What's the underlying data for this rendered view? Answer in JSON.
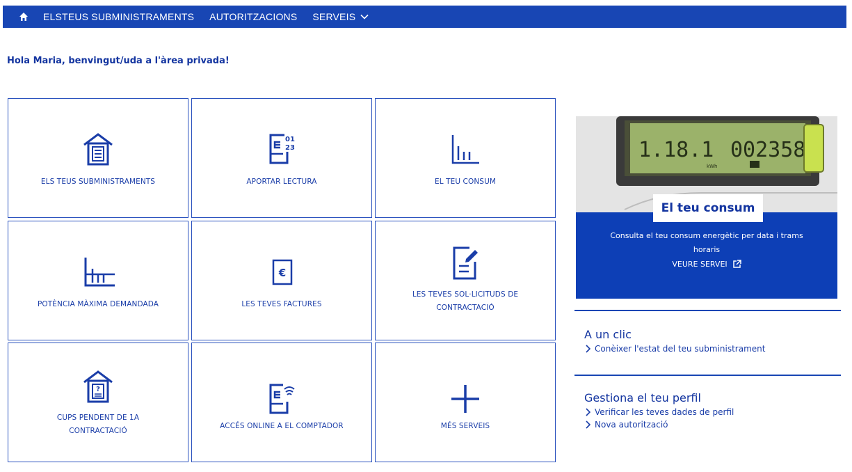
{
  "nav": {
    "home_icon": "home-icon",
    "items": [
      {
        "label": "ELSTEUS SUBMINISTRAMENTS"
      },
      {
        "label": "AUTORITZACIONS"
      },
      {
        "label": "SERVEIS"
      }
    ]
  },
  "greeting": "Hola Maria, benvingut/uda a l'àrea privada!",
  "tiles": [
    {
      "label": "ELS TEUS SUBMINISTRAMENTS",
      "icon": "house-document-icon"
    },
    {
      "label": "APORTAR LECTURA",
      "icon": "meter-reading-icon"
    },
    {
      "label": "EL TEU CONSUM",
      "icon": "bar-chart-icon"
    },
    {
      "label": "POTÈNCIA MÀXIMA DEMANDADA",
      "icon": "max-power-chart-icon"
    },
    {
      "label": "LES TEVES FACTURES",
      "icon": "euro-invoice-icon"
    },
    {
      "label": "LES TEVES SOL·LICITUDS DE CONTRACTACIÓ",
      "icon": "document-edit-icon"
    },
    {
      "label": "CUPS PENDENT DE 1A CONTRACTACIÓ",
      "icon": "house-question-icon"
    },
    {
      "label": "ACCÉS ONLINE A EL COMPTADOR",
      "icon": "meter-wifi-icon"
    },
    {
      "label": "MÉS SERVEIS",
      "icon": "plus-icon"
    }
  ],
  "promo": {
    "meter_left": "1.18.1",
    "meter_right": "002358",
    "meter_unit": "kWh",
    "title": "El teu consum",
    "description": "Consulta el teu consum energètic per data i trams horaris",
    "cta": "VEURE SERVEI"
  },
  "quick": {
    "title": "A un clic",
    "links": [
      "Conèixer l'estat del teu subministrament"
    ]
  },
  "profile": {
    "title": "Gestiona el teu perfil",
    "links": [
      "Verificar les teves dades de perfil",
      "Nova autorització"
    ]
  },
  "colors": {
    "primary": "#1846b4",
    "tile_border": "#2a52be",
    "promo_blue": "#0d3fb6"
  }
}
